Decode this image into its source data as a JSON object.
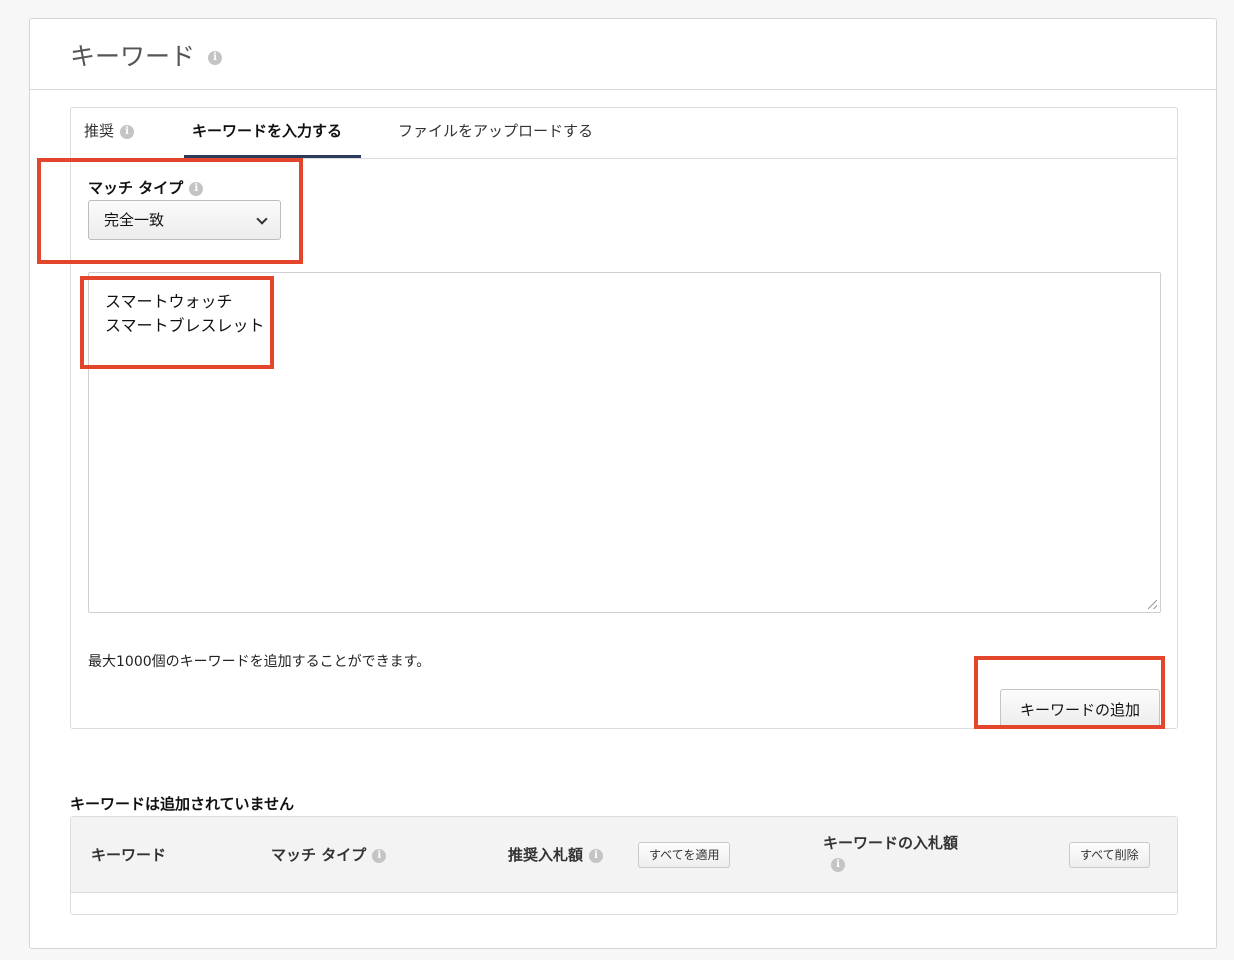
{
  "panel": {
    "title": "キーワード"
  },
  "tabs": [
    {
      "label": "推奨"
    },
    {
      "label": "キーワードを入力する"
    },
    {
      "label": "ファイルをアップロードする"
    }
  ],
  "match_type": {
    "label": "マッチ タイプ",
    "selected": "完全一致"
  },
  "keywords_input": {
    "lines": [
      "スマートウォッチ",
      "スマートブレスレット"
    ]
  },
  "hint": "最大1000個のキーワードを追加することができます。",
  "add_button": "キーワードの追加",
  "added": {
    "empty_title": "キーワードは追加されていません",
    "columns": {
      "keyword": "キーワード",
      "match_type": "マッチ タイプ",
      "suggested_bid": "推奨入札額",
      "keyword_bid": "キーワードの入札額"
    },
    "apply_all": "すべてを適用",
    "delete_all": "すべて削除"
  },
  "colors": {
    "highlight": "#e3452d",
    "tab_underline": "#2a3b5c"
  }
}
